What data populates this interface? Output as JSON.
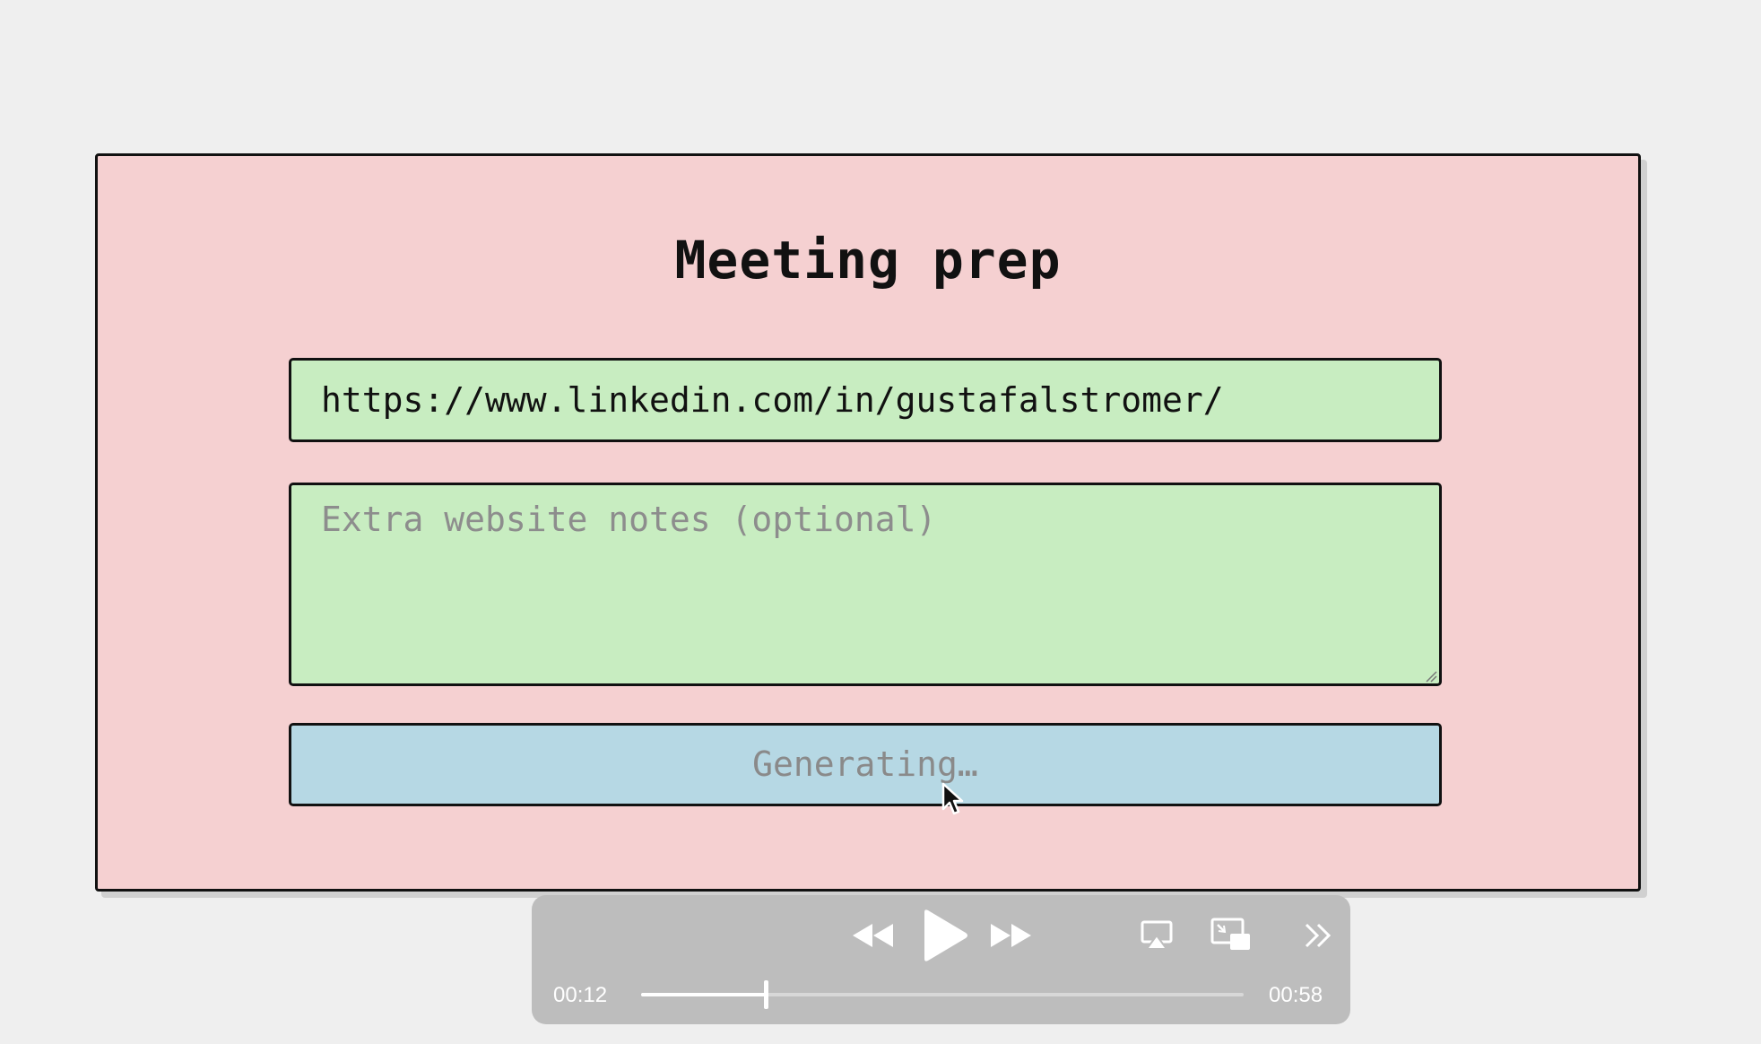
{
  "card": {
    "title": "Meeting prep",
    "url_value": "https://www.linkedin.com/in/gustafalstromer/",
    "notes_placeholder": "Extra website notes (optional)",
    "button_label": "Generating…"
  },
  "player": {
    "current_time": "00:12",
    "total_time": "00:58",
    "progress": 0.207,
    "icons": [
      "rewind-icon",
      "play-icon",
      "fast-forward-icon",
      "airplay-icon",
      "picture-in-picture-icon",
      "more-icon"
    ]
  },
  "colors": {
    "card_bg": "#f5d0d1",
    "field_bg": "#c8edc1",
    "button_bg": "#b6d8e4",
    "page_bg": "#efefef",
    "player_bg": "#bdbdbd"
  }
}
